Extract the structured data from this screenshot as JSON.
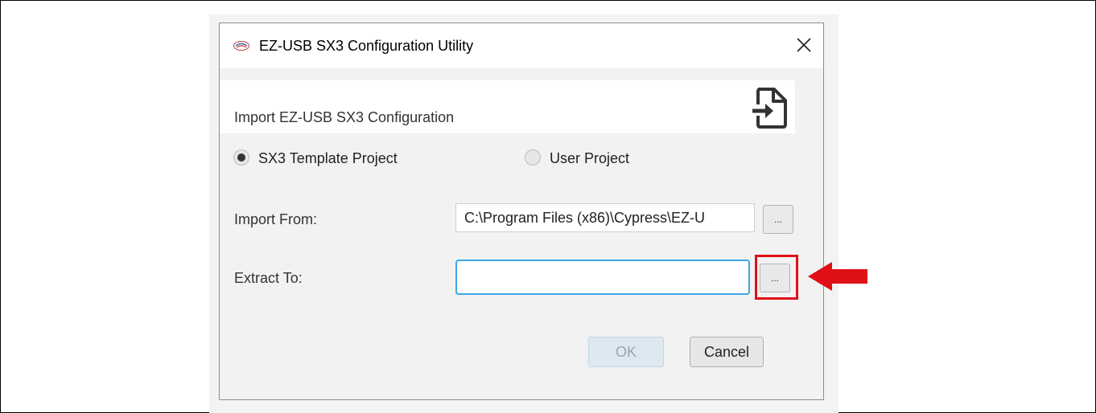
{
  "dialog": {
    "title": "EZ-USB SX3 Configuration Utility",
    "header_text": "Import EZ-USB SX3 Configuration",
    "radio_template_label": "SX3 Template Project",
    "radio_user_label": "User Project",
    "radio_selected": "template",
    "import_from_label": "Import From:",
    "import_from_value": "C:\\Program Files (x86)\\Cypress\\EZ-U",
    "extract_to_label": "Extract To:",
    "extract_to_value": "",
    "browse_label": "...",
    "ok_label": "OK",
    "cancel_label": "Cancel"
  },
  "colors": {
    "highlight": "#e01017",
    "focus_border": "#3da6e8",
    "ok_disabled_bg": "#dde9f1"
  },
  "icons": {
    "app": "cypress-logo-icon",
    "close": "close-icon",
    "import": "file-import-icon",
    "callout": "red-arrow-left-icon"
  }
}
